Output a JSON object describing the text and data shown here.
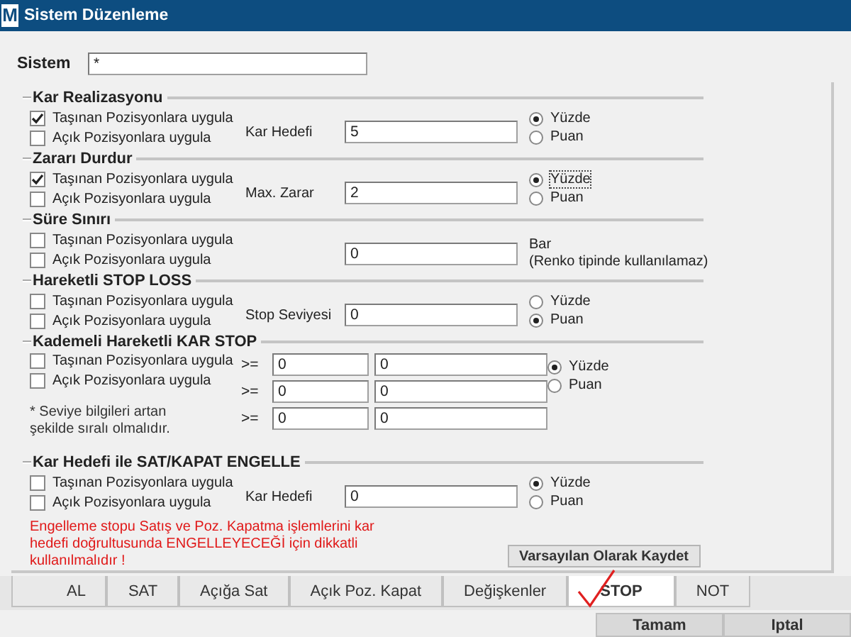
{
  "window": {
    "title": "Sistem Düzenleme",
    "app_icon": "M"
  },
  "system": {
    "label": "Sistem",
    "value": "*"
  },
  "sections": [
    {
      "title": "Kar Realizasyonu",
      "kind": "single",
      "options": [
        {
          "label": "Taşınan Pozisyonlara uygula",
          "checked": true
        },
        {
          "label": "Açık Pozisyonlara uygula",
          "checked": false
        }
      ],
      "field_label": "Kar Hedefi",
      "value": "5",
      "radios": [
        {
          "label": "Yüzde",
          "selected": true,
          "focused": false
        },
        {
          "label": "Puan",
          "selected": false,
          "focused": false
        }
      ]
    },
    {
      "title": "Zararı Durdur",
      "kind": "single",
      "options": [
        {
          "label": "Taşınan Pozisyonlara uygula",
          "checked": true
        },
        {
          "label": "Açık Pozisyonlara uygula",
          "checked": false
        }
      ],
      "field_label": "Max. Zarar",
      "value": "2",
      "radios": [
        {
          "label": "Yüzde",
          "selected": true,
          "focused": true
        },
        {
          "label": "Puan",
          "selected": false,
          "focused": false
        }
      ]
    },
    {
      "title": "Süre Sınırı",
      "kind": "single",
      "options": [
        {
          "label": "Taşınan Pozisyonlara uygula",
          "checked": false
        },
        {
          "label": "Açık Pozisyonlara uygula",
          "checked": false
        }
      ],
      "value": "0",
      "unit": "Bar",
      "unit_note": "(Renko tipinde kullanılamaz)"
    },
    {
      "title": "Hareketli STOP LOSS",
      "kind": "single",
      "options": [
        {
          "label": "Taşınan Pozisyonlara uygula",
          "checked": false
        },
        {
          "label": "Açık Pozisyonlara uygula",
          "checked": false
        }
      ],
      "field_label": "Stop Seviyesi",
      "value": "0",
      "radios": [
        {
          "label": "Yüzde",
          "selected": false,
          "focused": false
        },
        {
          "label": "Puan",
          "selected": true,
          "focused": false
        }
      ]
    },
    {
      "title": "Kademeli Hareketli KAR STOP",
      "kind": "ladder",
      "options": [
        {
          "label": "Taşınan Pozisyonlara uygula",
          "checked": false
        },
        {
          "label": "Açık Pozisyonlara uygula",
          "checked": false
        }
      ],
      "note": {
        "text": "* Seviye bilgileri artan şekilde sıralı olmalıdır.",
        "kind": "hint"
      },
      "rows": [
        {
          "operator": ">=",
          "from": "0",
          "to": "0"
        },
        {
          "operator": ">=",
          "from": "0",
          "to": "0"
        },
        {
          "operator": ">=",
          "from": "0",
          "to": "0"
        }
      ],
      "radios": [
        {
          "label": "Yüzde",
          "selected": true,
          "focused": false
        },
        {
          "label": "Puan",
          "selected": false,
          "focused": false
        }
      ]
    },
    {
      "title": "Kar Hedefi ile SAT/KAPAT ENGELLE",
      "kind": "single",
      "options": [
        {
          "label": "Taşınan Pozisyonlara uygula",
          "checked": false
        },
        {
          "label": "Açık Pozisyonlara uygula",
          "checked": false
        }
      ],
      "field_label": "Kar Hedefi",
      "value": "0",
      "radios": [
        {
          "label": "Yüzde",
          "selected": true,
          "focused": false
        },
        {
          "label": "Puan",
          "selected": false,
          "focused": false
        }
      ],
      "note": {
        "text": "Engelleme stopu Satış ve Poz. Kapatma işlemlerini kar hedefi doğrultusunda ENGELLEYECEĞİ için dikkatli kullanılmalıdır !",
        "kind": "warning"
      }
    }
  ],
  "save_default_button": "Varsayılan Olarak Kaydet",
  "tabs": [
    {
      "label": "AL",
      "selected": false
    },
    {
      "label": "SAT",
      "selected": false
    },
    {
      "label": "Açığa Sat",
      "selected": false
    },
    {
      "label": "Açık Poz. Kapat",
      "selected": false
    },
    {
      "label": "Değişkenler",
      "selected": false
    },
    {
      "label": "STOP",
      "selected": true
    },
    {
      "label": "NOT",
      "selected": false
    }
  ],
  "buttons": [
    "Tamam",
    "Iptal"
  ]
}
